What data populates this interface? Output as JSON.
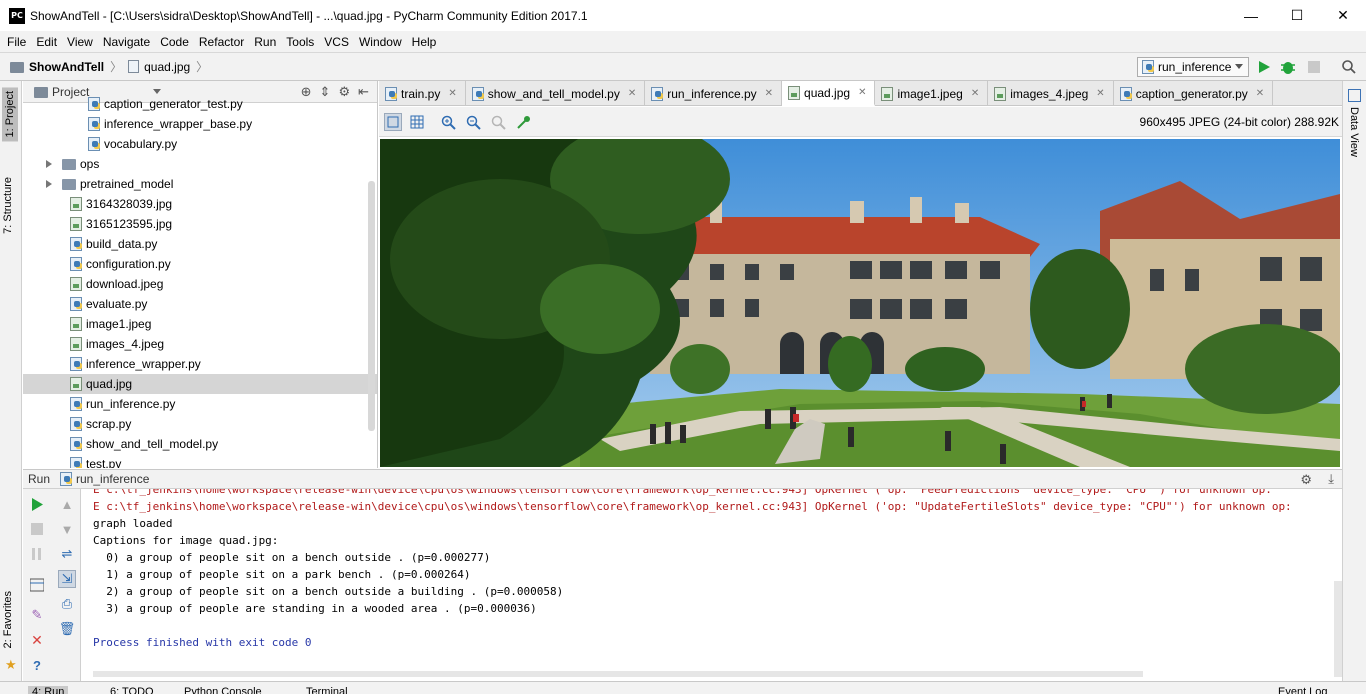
{
  "window": {
    "app_icon": "PC",
    "title": "ShowAndTell - [C:\\Users\\sidra\\Desktop\\ShowAndTell] - ...\\quad.jpg - PyCharm Community Edition 2017.1",
    "minimize": "—",
    "maximize": "☐",
    "close": "✕"
  },
  "menu": [
    "File",
    "Edit",
    "View",
    "Navigate",
    "Code",
    "Refactor",
    "Run",
    "Tools",
    "VCS",
    "Window",
    "Help"
  ],
  "breadcrumb": {
    "project": "ShowAndTell",
    "file": "quad.jpg"
  },
  "run_config": {
    "selected": "run_inference"
  },
  "left_stripe": {
    "project_tab": "1: Project",
    "structure_tab": "7: Structure",
    "favorites_tab": "2: Favorites"
  },
  "right_stripe": {
    "data_view_tab": "Data View"
  },
  "project_panel": {
    "label": "Project",
    "items": [
      {
        "name": "caption_generator_test.py",
        "type": "py",
        "indent": 2
      },
      {
        "name": "inference_wrapper_base.py",
        "type": "py",
        "indent": 2
      },
      {
        "name": "vocabulary.py",
        "type": "py",
        "indent": 2
      },
      {
        "name": "ops",
        "type": "dir",
        "indent": 1
      },
      {
        "name": "pretrained_model",
        "type": "dir",
        "indent": 1
      },
      {
        "name": "3164328039.jpg",
        "type": "img",
        "indent": 1
      },
      {
        "name": "3165123595.jpg",
        "type": "img",
        "indent": 1
      },
      {
        "name": "build_data.py",
        "type": "py",
        "indent": 1
      },
      {
        "name": "configuration.py",
        "type": "py",
        "indent": 1
      },
      {
        "name": "download.jpeg",
        "type": "img",
        "indent": 1
      },
      {
        "name": "evaluate.py",
        "type": "py",
        "indent": 1
      },
      {
        "name": "image1.jpeg",
        "type": "img",
        "indent": 1
      },
      {
        "name": "images_4.jpeg",
        "type": "img",
        "indent": 1
      },
      {
        "name": "inference_wrapper.py",
        "type": "py",
        "indent": 1
      },
      {
        "name": "quad.jpg",
        "type": "img",
        "indent": 1,
        "selected": true
      },
      {
        "name": "run_inference.py",
        "type": "py",
        "indent": 1
      },
      {
        "name": "scrap.py",
        "type": "py",
        "indent": 1
      },
      {
        "name": "show_and_tell_model.py",
        "type": "py",
        "indent": 1
      },
      {
        "name": "test.py",
        "type": "py",
        "indent": 1
      }
    ]
  },
  "editor_tabs": [
    {
      "label": "train.py",
      "type": "py"
    },
    {
      "label": "show_and_tell_model.py",
      "type": "py"
    },
    {
      "label": "run_inference.py",
      "type": "py"
    },
    {
      "label": "quad.jpg",
      "type": "img",
      "active": true
    },
    {
      "label": "image1.jpeg",
      "type": "img"
    },
    {
      "label": "images_4.jpeg",
      "type": "img"
    },
    {
      "label": "caption_generator.py",
      "type": "py"
    }
  ],
  "image_info": "960x495 JPEG (24-bit color) 288.92K",
  "run_panel": {
    "label": "Run",
    "tab": "run_inference",
    "console": [
      {
        "text": "E c:\\tf_jenkins\\home\\workspace\\release-win\\device\\cpu\\os\\windows\\tensorflow\\core\\framework\\op_kernel.cc:943] OpKernel ('op: \"FeedPredictions\" device_type: \"CPU\"') for unknown op:",
        "kind": "err"
      },
      {
        "text": "E c:\\tf_jenkins\\home\\workspace\\release-win\\device\\cpu\\os\\windows\\tensorflow\\core\\framework\\op_kernel.cc:943] OpKernel ('op: \"UpdateFertileSlots\" device_type: \"CPU\"') for unknown op:",
        "kind": "err"
      },
      {
        "text": "graph loaded",
        "kind": "out"
      },
      {
        "text": "Captions for image quad.jpg:",
        "kind": "out"
      },
      {
        "text": "  0) a group of people sit on a bench outside . (p=0.000277)",
        "kind": "out"
      },
      {
        "text": "  1) a group of people sit on a park bench . (p=0.000264)",
        "kind": "out"
      },
      {
        "text": "  2) a group of people sit on a bench outside a building . (p=0.000058)",
        "kind": "out"
      },
      {
        "text": "  3) a group of people are standing in a wooded area . (p=0.000036)",
        "kind": "out"
      },
      {
        "text": "",
        "kind": "out"
      },
      {
        "text": "Process finished with exit code 0",
        "kind": "blue"
      }
    ]
  },
  "bottom_tabs": [
    "4: Run",
    "6: TODO",
    "Python Console",
    "Terminal",
    "Event Log"
  ],
  "colors": {
    "accent": "#2f6cb2",
    "error": "#b11a1a",
    "exit": "#2838a8",
    "run_green": "#21a33b"
  }
}
